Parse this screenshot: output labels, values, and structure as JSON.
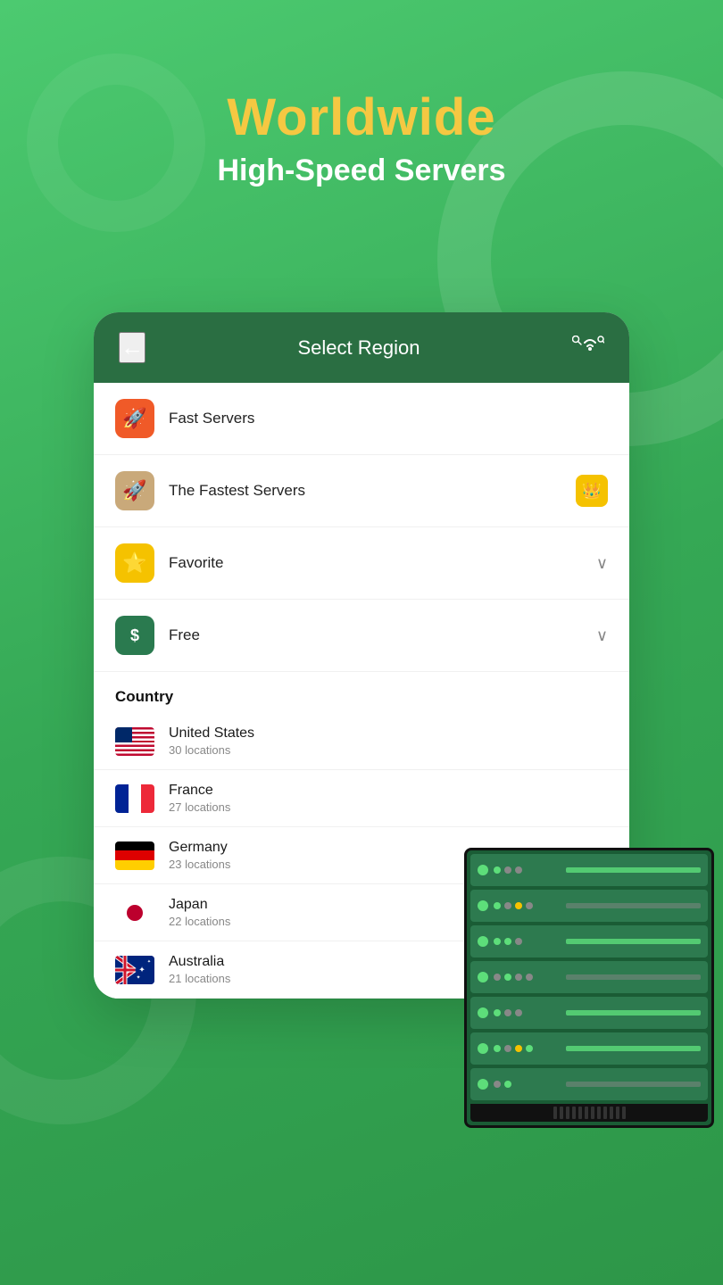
{
  "header": {
    "title_line1": "Worldwide",
    "title_line2": "High-Speed Servers"
  },
  "card": {
    "back_label": "←",
    "title": "Select Region",
    "menu_items": [
      {
        "id": "fast-servers",
        "icon": "🚀",
        "icon_style": "orange",
        "label": "Fast Servers",
        "right": null
      },
      {
        "id": "fastest-servers",
        "icon": "🚀",
        "icon_style": "tan",
        "label": "The Fastest Servers",
        "right": "crown"
      },
      {
        "id": "favorite",
        "icon": "⭐",
        "icon_style": "yellow",
        "label": "Favorite",
        "right": "chevron"
      },
      {
        "id": "free",
        "icon": "$",
        "icon_style": "green",
        "label": "Free",
        "right": "chevron"
      }
    ],
    "country_section_label": "Country",
    "countries": [
      {
        "id": "us",
        "flag": "us",
        "name": "United States",
        "locations": "30 locations"
      },
      {
        "id": "fr",
        "flag": "fr",
        "name": "France",
        "locations": "27 locations"
      },
      {
        "id": "de",
        "flag": "de",
        "name": "Germany",
        "locations": "23 locations"
      },
      {
        "id": "jp",
        "flag": "jp",
        "name": "Japan",
        "locations": "22 locations"
      },
      {
        "id": "au",
        "flag": "au",
        "name": "Australia",
        "locations": "21 locations"
      }
    ]
  },
  "colors": {
    "bg_green": "#3cb966",
    "dark_green": "#2a6e42",
    "title_yellow": "#f5c842",
    "white": "#ffffff"
  }
}
